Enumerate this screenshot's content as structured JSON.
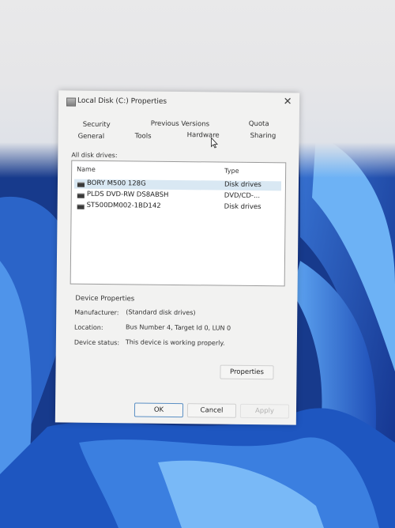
{
  "window": {
    "title": "Local Disk (C:) Properties",
    "close_glyph": "✕"
  },
  "tabs": {
    "row1": [
      "Security",
      "Previous Versions",
      "Quota"
    ],
    "row2": [
      "General",
      "Tools",
      "Hardware",
      "Sharing"
    ],
    "active": "Hardware"
  },
  "drives_section": {
    "label": "All disk drives:",
    "columns": {
      "name": "Name",
      "type": "Type"
    },
    "rows": [
      {
        "name": "BORY M500 128G",
        "type": "Disk drives",
        "selected": true
      },
      {
        "name": "PLDS DVD-RW DS8ABSH",
        "type": "DVD/CD-...",
        "selected": false
      },
      {
        "name": "ST500DM002-1BD142",
        "type": "Disk drives",
        "selected": false
      }
    ]
  },
  "device_properties": {
    "heading": "Device Properties",
    "manufacturer_label": "Manufacturer:",
    "manufacturer_value": "(Standard disk drives)",
    "location_label": "Location:",
    "location_value": "Bus Number 4, Target Id 0, LUN 0",
    "status_label": "Device status:",
    "status_value": "This device is working properly."
  },
  "buttons": {
    "properties": "Properties",
    "ok": "OK",
    "cancel": "Cancel",
    "apply": "Apply"
  },
  "colors": {
    "wallpaper_blue": "#1d3f8f",
    "selection": "#d9e8f3",
    "primary_border": "#5a8fc4"
  }
}
